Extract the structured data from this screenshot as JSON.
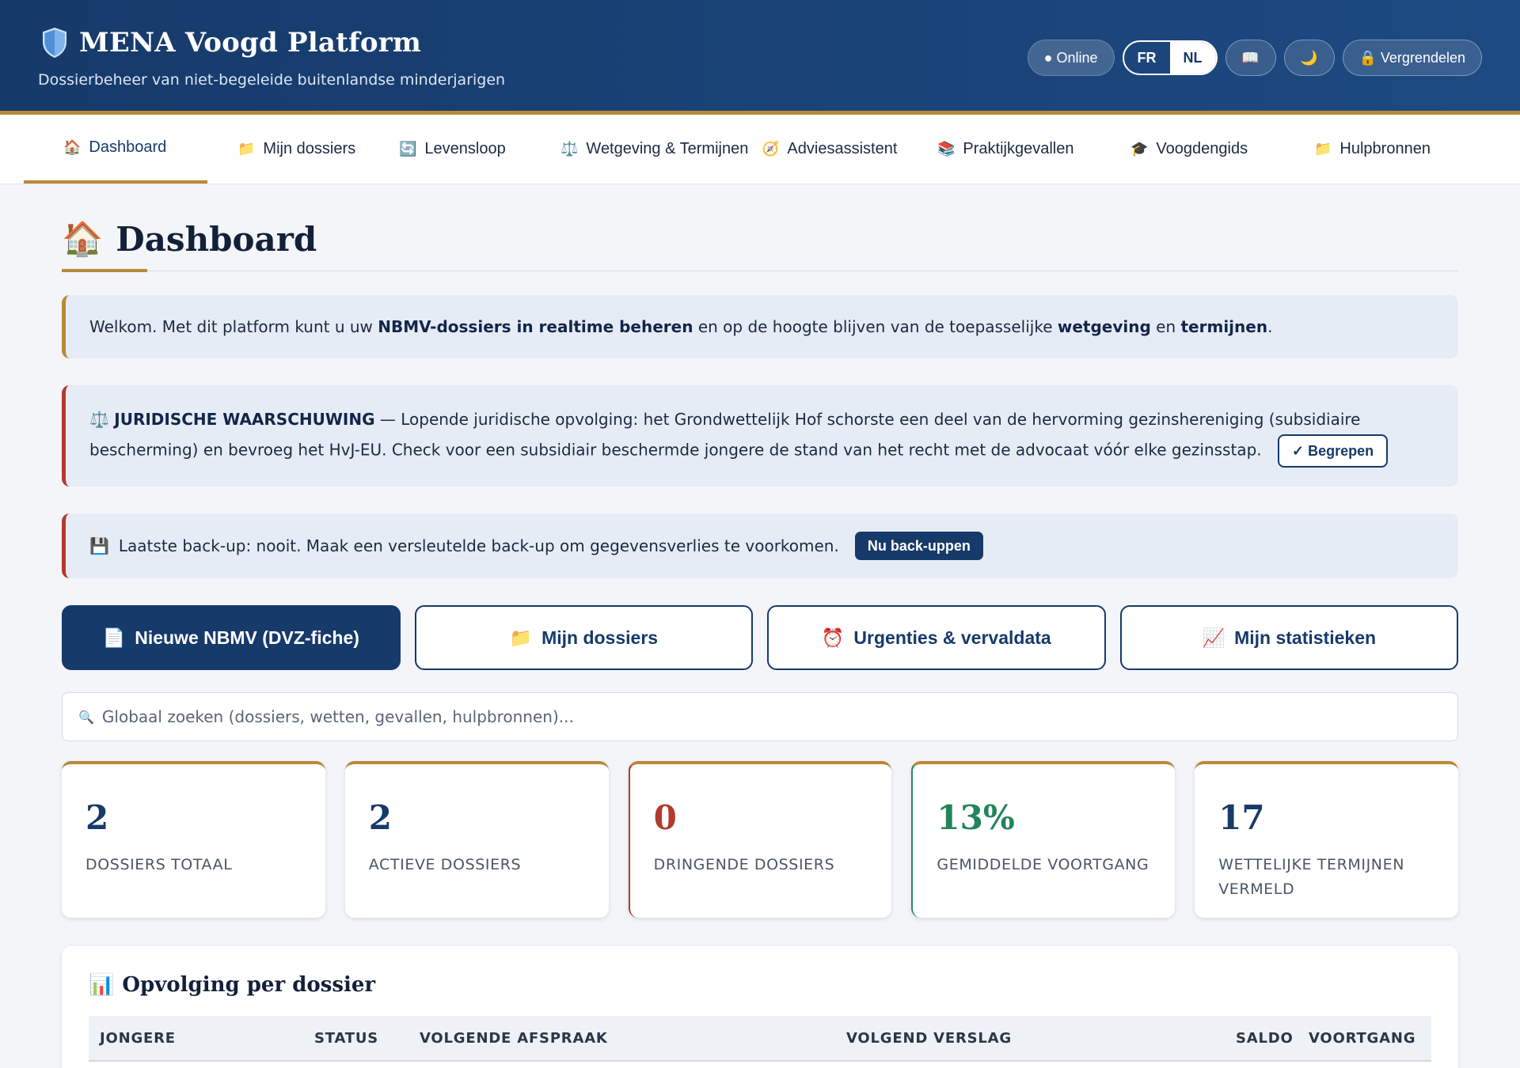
{
  "header": {
    "title": "MENA Voogd Platform",
    "subtitle": "Dossierbeheer van niet-begeleide buitenlandse minderjarigen",
    "status": "● Online",
    "lang_fr": "FR",
    "lang_nl": "NL",
    "guide_icon": "📖",
    "theme_icon": "🌙",
    "lock_label": "🔒 Vergrendelen"
  },
  "nav": {
    "items": [
      {
        "icon": "🏠",
        "label": "Dashboard"
      },
      {
        "icon": "📁",
        "label": "Mijn dossiers"
      },
      {
        "icon": "🔄",
        "label": "Levensloop"
      },
      {
        "icon": "⚖️",
        "label": "Wetgeving & Termijnen"
      },
      {
        "icon": "🧭",
        "label": "Adviesassistent"
      },
      {
        "icon": "📚",
        "label": "Praktijkgevallen"
      },
      {
        "icon": "🎓",
        "label": "Voogdengids"
      },
      {
        "icon": "📁",
        "label": "Hulpbronnen"
      }
    ]
  },
  "page": {
    "title_icon": "🏠",
    "title": "Dashboard"
  },
  "welcome": {
    "t1": "Welkom. Met dit platform kunt u uw ",
    "b1": "NBMV-dossiers in realtime beheren",
    "t2": " en op de hoogte blijven van de toepasselijke ",
    "b2": "wetgeving",
    "t3": " en ",
    "b3": "termijnen",
    "t4": "."
  },
  "legal": {
    "icon": "⚖️",
    "heading": "JURIDISCHE WAARSCHUWING",
    "text": " — Lopende juridische opvolging: het Grondwettelijk Hof schorste een deel van de hervorming gezinshereniging (subsidiaire bescherming) en bevroeg het HvJ-EU. Check voor een subsidiair beschermde jongere de stand van het recht met de advocaat vóór elke gezinsstap.",
    "button": "✓ Begrepen"
  },
  "backup": {
    "icon": "💾",
    "text": "Laatste back-up: nooit. Maak een versleutelde back-up om gegevensverlies te voorkomen.",
    "button": "Nu back-uppen"
  },
  "actions": [
    {
      "icon": "📄",
      "label": "Nieuwe NBMV (DVZ-fiche)"
    },
    {
      "icon": "📁",
      "label": "Mijn dossiers"
    },
    {
      "icon": "⏰",
      "label": "Urgenties & vervaldata"
    },
    {
      "icon": "📈",
      "label": "Mijn statistieken"
    }
  ],
  "search": {
    "icon": "🔍",
    "placeholder": "Globaal zoeken (dossiers, wetten, gevallen, hulpbronnen)..."
  },
  "stats": [
    {
      "value": "2",
      "label": "Dossiers totaal"
    },
    {
      "value": "2",
      "label": "Actieve dossiers"
    },
    {
      "value": "0",
      "label": "Dringende dossiers"
    },
    {
      "value": "13%",
      "label": "Gemiddelde voortgang"
    },
    {
      "value": "17",
      "label": "Wettelijke termijnen vermeld"
    }
  ],
  "panel": {
    "icon": "📊",
    "title": "Opvolging per dossier",
    "columns": [
      "JONGERE",
      "STATUS",
      "VOLGENDE AFSPRAAK",
      "VOLGEND VERSLAG",
      "SALDO",
      "VOORTGANG"
    ]
  },
  "colors": {
    "primary": "#163a6a",
    "accent_gold": "#b8893a",
    "danger": "#b23a2e",
    "success": "#23835a"
  }
}
